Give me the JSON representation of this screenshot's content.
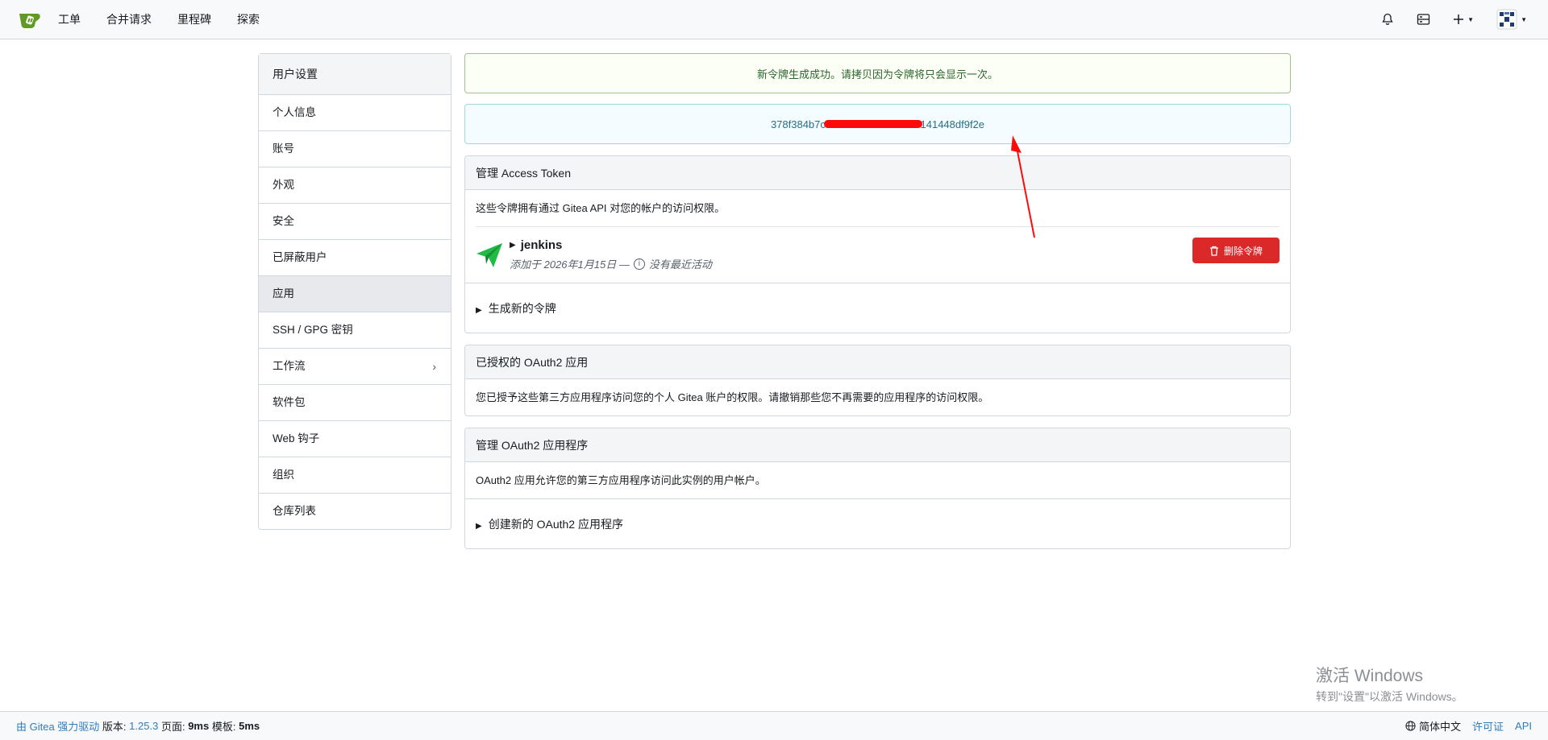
{
  "nav": {
    "items": [
      "工单",
      "合并请求",
      "里程碑",
      "探索"
    ]
  },
  "sidebar": {
    "title": "用户设置",
    "items": [
      {
        "label": "个人信息"
      },
      {
        "label": "账号"
      },
      {
        "label": "外观"
      },
      {
        "label": "安全"
      },
      {
        "label": "已屏蔽用户"
      },
      {
        "label": "应用",
        "active": true
      },
      {
        "label": "SSH / GPG 密钥"
      },
      {
        "label": "工作流"
      },
      {
        "label": "软件包"
      },
      {
        "label": "Web 钩子"
      },
      {
        "label": "组织"
      },
      {
        "label": "仓库列表"
      }
    ]
  },
  "alerts": {
    "success": "新令牌生成成功。请拷贝因为令牌将只会显示一次。",
    "token_prefix": "378f384b7cf",
    "token_suffix": "141448df9f2e"
  },
  "access_tokens": {
    "title": "管理 Access Token",
    "description": "这些令牌拥有通过 Gitea API 对您的帐户的访问权限。",
    "token": {
      "name": "jenkins",
      "added": "添加于 2026年1月15日 —",
      "activity": "没有最近活动",
      "delete_label": "删除令牌"
    },
    "generate_label": "生成新的令牌"
  },
  "oauth_authorized": {
    "title": "已授权的 OAuth2 应用",
    "description": "您已授予这些第三方应用程序访问您的个人 Gitea 账户的权限。请撤销那些您不再需要的应用程序的访问权限。"
  },
  "oauth_manage": {
    "title": "管理 OAuth2 应用程序",
    "description": "OAuth2 应用允许您的第三方应用程序访问此实例的用户帐户。",
    "create_label": "创建新的 OAuth2 应用程序"
  },
  "watermark": {
    "title": "激活 Windows",
    "subtitle": "转到\"设置\"以激活 Windows。"
  },
  "footer": {
    "powered": "由 Gitea 强力驱动",
    "version_label": "版本:",
    "version": "1.25.3",
    "page_label": "页面:",
    "page_time": "9ms",
    "template_label": "模板:",
    "template_time": "5ms",
    "language": "简体中文",
    "license": "许可证",
    "api": "API"
  },
  "colors": {
    "danger": "#db2828",
    "success_text": "#2c662d",
    "info_text": "#276f86",
    "link": "#2e7dbd",
    "brand": "#609926"
  }
}
